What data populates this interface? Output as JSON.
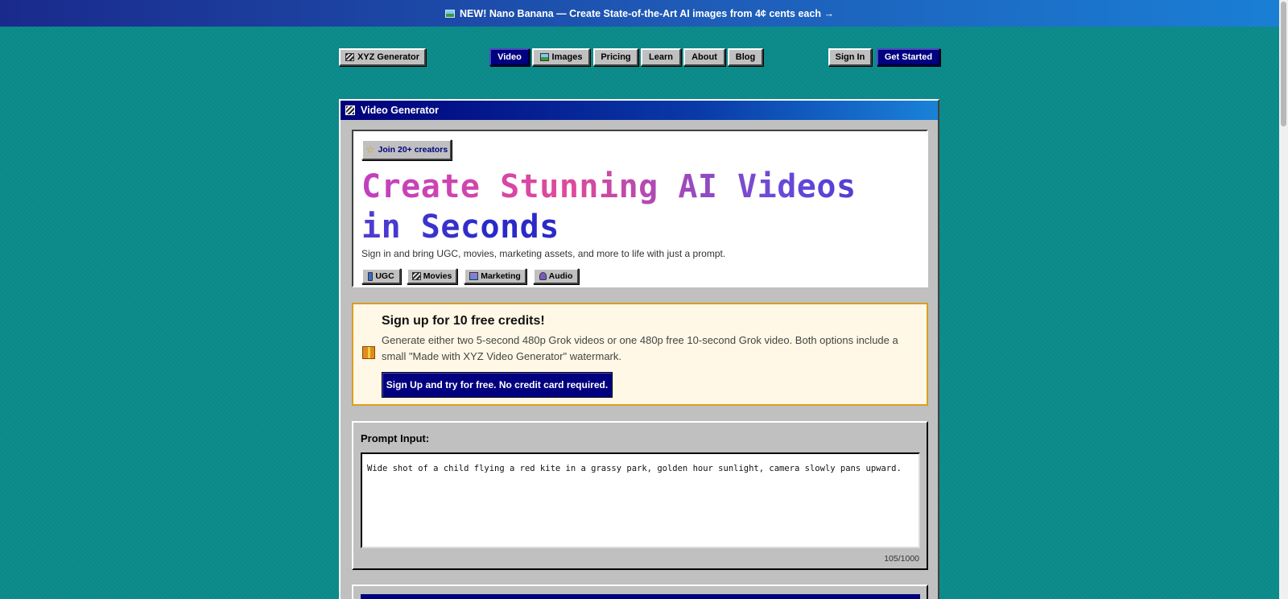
{
  "banner": {
    "text": "NEW! Nano Banana — Create State-of-the-Art AI images from 4¢ cents each →",
    "icon": "image-icon"
  },
  "nav": {
    "brand": "XYZ Generator",
    "links": [
      "Video",
      "Images",
      "Pricing",
      "Learn",
      "About",
      "Blog"
    ],
    "active": "Video",
    "sign_in": "Sign In",
    "get_started": "Get Started"
  },
  "window": {
    "title": "Video Generator",
    "hero": {
      "badge": "Join 20+ creators",
      "headline": "Create Stunning AI Videos in Seconds",
      "subtext": "Sign in and bring UGC, movies, marketing assets, and more to life with just a prompt.",
      "chips": [
        "UGC",
        "Movies",
        "Marketing",
        "Audio"
      ]
    },
    "promo": {
      "title": "Sign up for 10 free credits!",
      "description": "Generate either two 5-second 480p Grok videos or one 480p free 10-second Grok video. Both options include a small \"Made with XYZ Video Generator\" watermark.",
      "button": "Sign Up and try for free. No credit card required."
    },
    "prompt": {
      "label": "Prompt Input:",
      "value": "Wide shot of a child flying a red kite in a grassy park, golden hour sunlight, camera slowly pans upward.",
      "counter": "105/1000"
    }
  },
  "colors": {
    "background": "#0b8a8a",
    "accent": "#000080",
    "window_face": "#c0c0c0",
    "promo_border": "#d8a020"
  }
}
